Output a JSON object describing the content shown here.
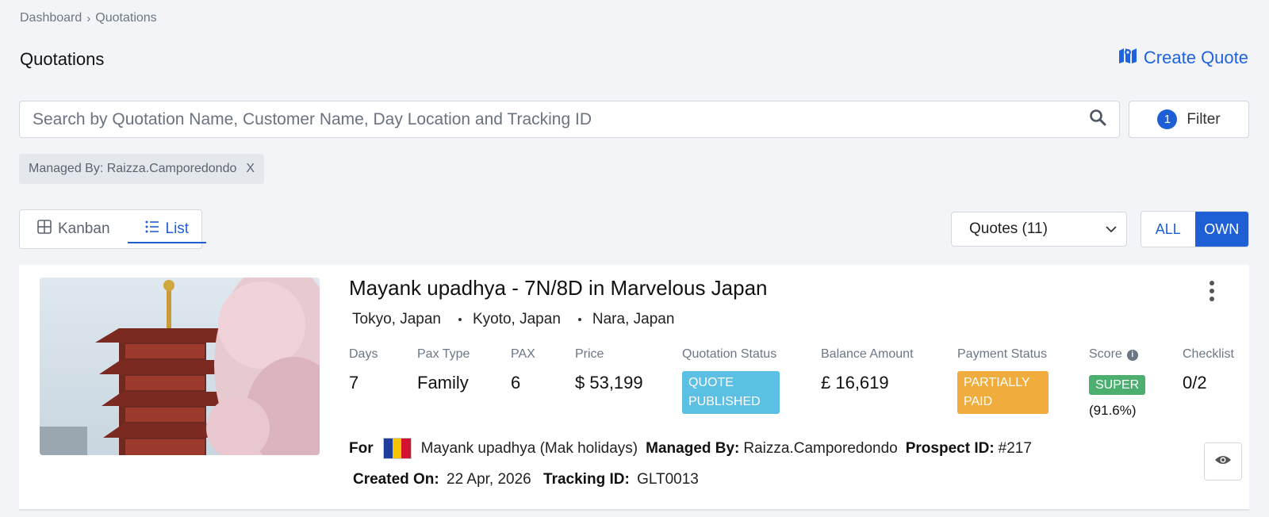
{
  "breadcrumb": {
    "items": [
      "Dashboard",
      "Quotations"
    ]
  },
  "page": {
    "title": "Quotations",
    "create_label": "Create Quote"
  },
  "search": {
    "placeholder": "Search by Quotation Name, Customer Name, Day Location and Tracking ID"
  },
  "filter": {
    "count": "1",
    "label": "Filter"
  },
  "active_filter": {
    "label": "Managed By: Raizza.Camporedondo",
    "remove": "X"
  },
  "views": {
    "kanban": "Kanban",
    "list": "List",
    "active": "List"
  },
  "quotes_select": {
    "value": "Quotes (11)"
  },
  "scope": {
    "all": "ALL",
    "own": "OWN",
    "active": "OWN"
  },
  "quote": {
    "title": "Mayank upadhya - 7N/8D in Marvelous Japan",
    "locations": [
      "Tokyo, Japan",
      "Kyoto, Japan",
      "Nara, Japan"
    ],
    "stats": {
      "days": {
        "label": "Days",
        "value": "7"
      },
      "pax_type": {
        "label": "Pax Type",
        "value": "Family"
      },
      "pax": {
        "label": "PAX",
        "value": "6"
      },
      "price": {
        "label": "Price",
        "value": "$ 53,199"
      },
      "quotation_status": {
        "label": "Quotation Status",
        "value": "QUOTE PUBLISHED",
        "color": "#5bc0e4"
      },
      "balance": {
        "label": "Balance Amount",
        "value": "£ 16,619"
      },
      "payment_status": {
        "label": "Payment Status",
        "value": "PARTIALLY PAID",
        "color": "#f0ad3e"
      },
      "score": {
        "label": "Score",
        "badge": "SUPER",
        "percent": "(91.6%)",
        "color": "#4caf6f"
      },
      "checklist": {
        "label": "Checklist",
        "value": "0/2"
      }
    },
    "for_label": "For",
    "customer": "Mayank upadhya (Mak holidays)",
    "managed_by_label": "Managed By:",
    "managed_by": "Raizza.Camporedondo",
    "prospect_label": "Prospect ID:",
    "prospect_id": "#217",
    "created_label": "Created On:",
    "created_on": "22 Apr, 2026",
    "tracking_label": "Tracking ID:",
    "tracking_id": "GLT0013"
  },
  "colors": {
    "accent": "#1f5fd6",
    "link": "#1f63e0"
  }
}
